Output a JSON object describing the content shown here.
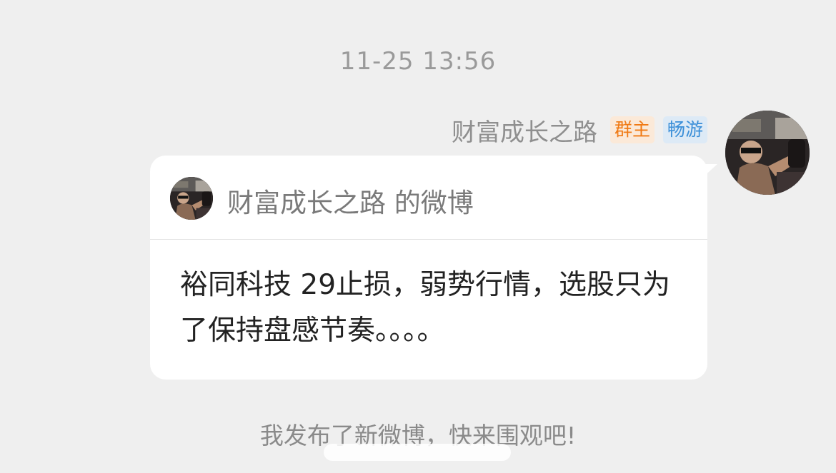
{
  "message": {
    "timestamp": "11-25 13:56",
    "sender": {
      "name": "财富成长之路",
      "badges": [
        "群主",
        "畅游"
      ],
      "avatar": "avatar-photo"
    },
    "card": {
      "title": "财富成长之路 的微博",
      "body": "裕同科技 29止损，弱势行情，选股只为了保持盘感节奏。。。。"
    }
  },
  "footer": {
    "text": "我发布了新微博，快来围观吧!"
  },
  "colors": {
    "background": "#efefef",
    "bubble": "#ffffff",
    "owner_badge_text": "#f07a14",
    "flow_badge_text": "#3b8fd8"
  }
}
